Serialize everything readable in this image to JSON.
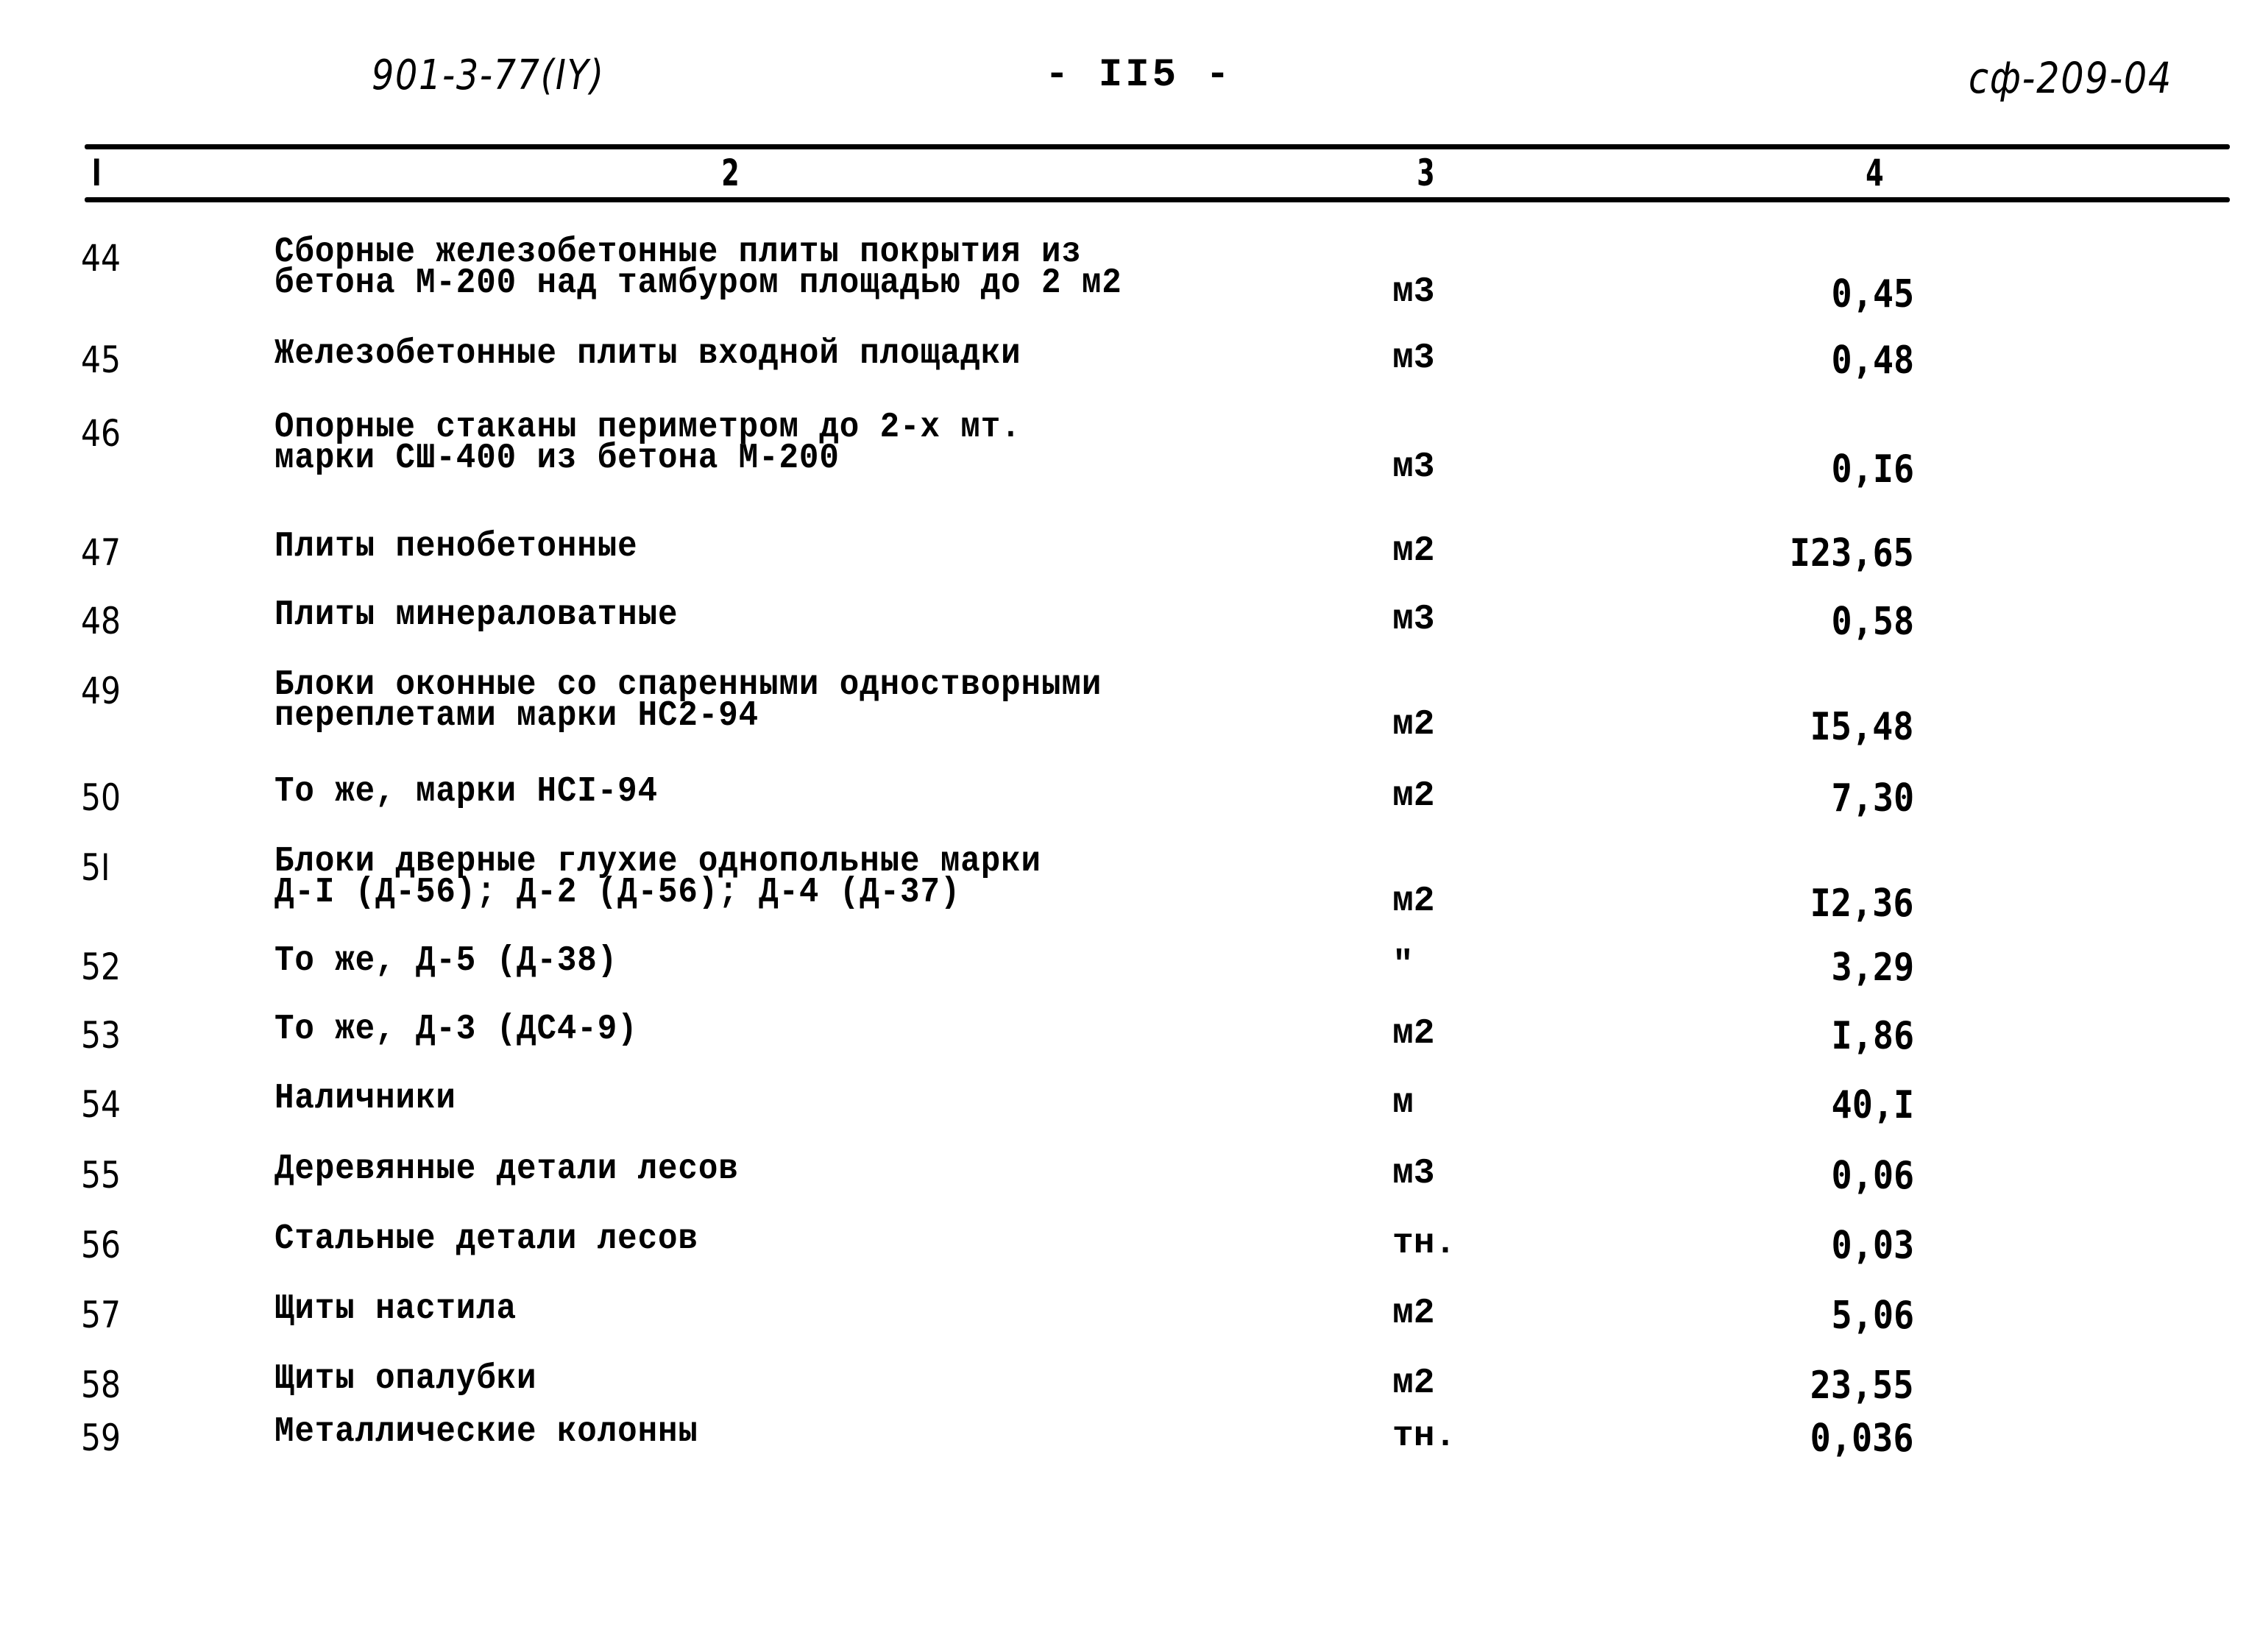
{
  "header": {
    "doc_code": "901-3-77(IY)",
    "page_number": "- II5 -",
    "sheet_code": "сф-209-04"
  },
  "table": {
    "columns": [
      "I",
      "2",
      "3",
      "4"
    ],
    "rows": [
      {
        "num": "44",
        "desc": [
          "Сборные железобетонные плиты покрытия из",
          "бетона М-200 над тамбуром площадью до 2 м2"
        ],
        "unit": "м3",
        "qty": "0,45"
      },
      {
        "num": "45",
        "desc": [
          "Железобетонные плиты входной площадки"
        ],
        "unit": "м3",
        "qty": "0,48"
      },
      {
        "num": "46",
        "desc": [
          "Опорные стаканы периметром до 2-х мт.",
          "марки СШ-400 из бетона М-200"
        ],
        "unit": "м3",
        "qty": "0,I6"
      },
      {
        "num": "47",
        "desc": [
          "Плиты пенобетонные"
        ],
        "unit": "м2",
        "qty": "I23,65"
      },
      {
        "num": "48",
        "desc": [
          "Плиты минераловатные"
        ],
        "unit": "м3",
        "qty": "0,58"
      },
      {
        "num": "49",
        "desc": [
          "Блоки оконные со спаренными одностворными",
          "переплетами марки НС2-94"
        ],
        "unit": "м2",
        "qty": "I5,48"
      },
      {
        "num": "50",
        "desc": [
          "То же, марки НСI-94"
        ],
        "unit": "м2",
        "qty": "7,30"
      },
      {
        "num": "5I",
        "desc": [
          "Блоки дверные глухие однопольные марки",
          "Д-I (Д-56); Д-2 (Д-56); Д-4 (Д-37)"
        ],
        "unit": "м2",
        "qty": "I2,36"
      },
      {
        "num": "52",
        "desc": [
          "То же, Д-5 (Д-38)"
        ],
        "unit": "\"",
        "qty": "3,29"
      },
      {
        "num": "53",
        "desc": [
          "То же, Д-3 (ДС4-9)"
        ],
        "unit": "м2",
        "qty": "I,86"
      },
      {
        "num": "54",
        "desc": [
          "Наличники"
        ],
        "unit": "м",
        "qty": "40,I"
      },
      {
        "num": "55",
        "desc": [
          "Деревянные детали лесов"
        ],
        "unit": "м3",
        "qty": "0,06"
      },
      {
        "num": "56",
        "desc": [
          "Стальные детали лесов"
        ],
        "unit": "тн.",
        "qty": "0,03"
      },
      {
        "num": "57",
        "desc": [
          "Щиты настила"
        ],
        "unit": "м2",
        "qty": "5,06"
      },
      {
        "num": "58",
        "desc": [
          "Щиты опалубки"
        ],
        "unit": "м2",
        "qty": "23,55"
      },
      {
        "num": "59",
        "desc": [
          "Металлические колонны"
        ],
        "unit": "тн.",
        "qty": "0,036"
      }
    ]
  }
}
